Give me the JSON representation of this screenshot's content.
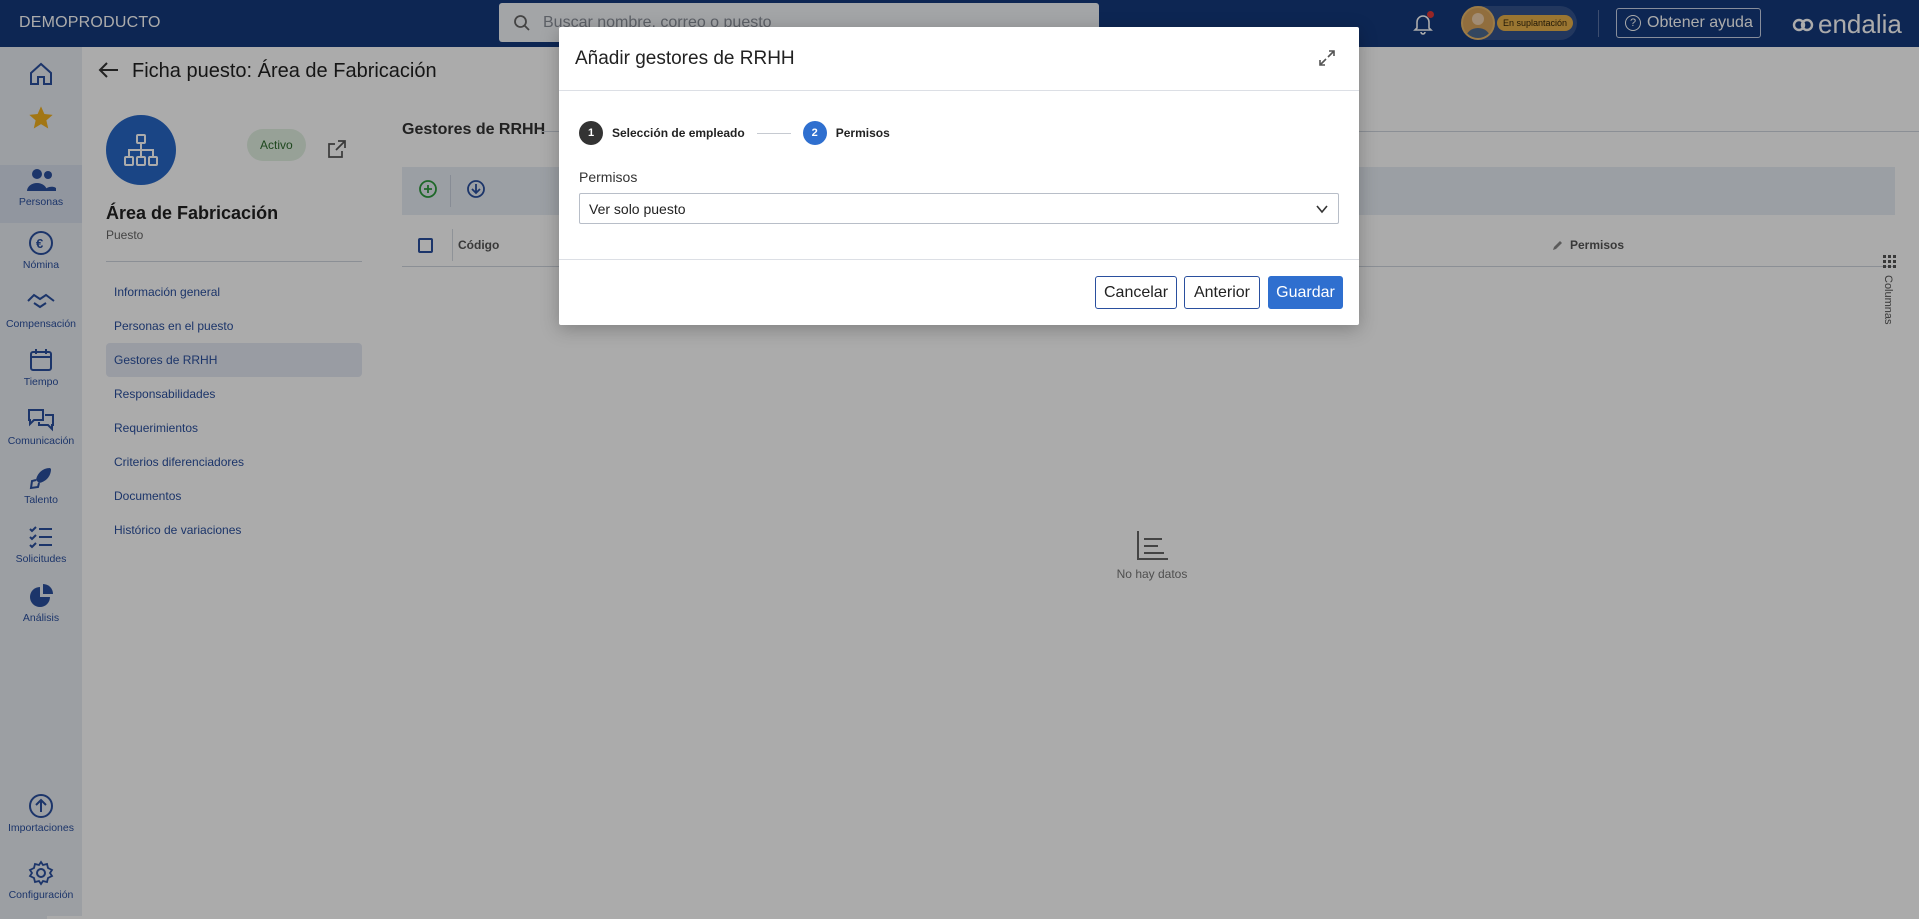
{
  "app": {
    "tenant": "DEMOPRODUCTO",
    "search_placeholder": "Buscar nombre, correo o puesto",
    "impersonation_badge": "En suplantación",
    "help_label": "Obtener ayuda",
    "logo_text": "endalia"
  },
  "rail": {
    "items": [
      {
        "label": "",
        "icon": "home-icon"
      },
      {
        "label": "",
        "icon": "star-icon"
      },
      {
        "label": "Personas",
        "icon": "people-icon"
      },
      {
        "label": "Nómina",
        "icon": "euro-icon"
      },
      {
        "label": "Compensación",
        "icon": "handshake-icon"
      },
      {
        "label": "Tiempo",
        "icon": "calendar-icon"
      },
      {
        "label": "Comunicación",
        "icon": "chat-icon"
      },
      {
        "label": "Talento",
        "icon": "rocket-icon"
      },
      {
        "label": "Solicitudes",
        "icon": "checklist-icon"
      },
      {
        "label": "Análisis",
        "icon": "pie-chart-icon"
      },
      {
        "label": "Importaciones",
        "icon": "upload-icon"
      },
      {
        "label": "Configuración",
        "icon": "gear-icon"
      }
    ]
  },
  "page": {
    "title": "Ficha puesto: Área de Fabricación",
    "status": "Activo",
    "entity_name": "Área de Fabricación",
    "entity_type": "Puesto",
    "menu": [
      "Información general",
      "Personas en el puesto",
      "Gestores de RRHH",
      "Responsabilidades",
      "Requerimientos",
      "Criterios diferenciadores",
      "Documentos",
      "Histórico de variaciones"
    ],
    "section_title": "Gestores de RRHH",
    "table": {
      "col_code": "Código",
      "col_permissions": "Permisos",
      "empty_text": "No hay datos",
      "columns_tab": "Columnas"
    }
  },
  "modal": {
    "title": "Añadir gestores de RRHH",
    "steps": [
      {
        "num": "1",
        "label": "Selección de empleado"
      },
      {
        "num": "2",
        "label": "Permisos"
      }
    ],
    "field_label": "Permisos",
    "select_value": "Ver solo puesto",
    "cancel": "Cancelar",
    "previous": "Anterior",
    "save": "Guardar"
  },
  "colors": {
    "topbar": "#14397c",
    "accent": "#2f6fcf",
    "rail_label": "#2a4f9e",
    "active_status_bg": "#e1f0e1"
  }
}
